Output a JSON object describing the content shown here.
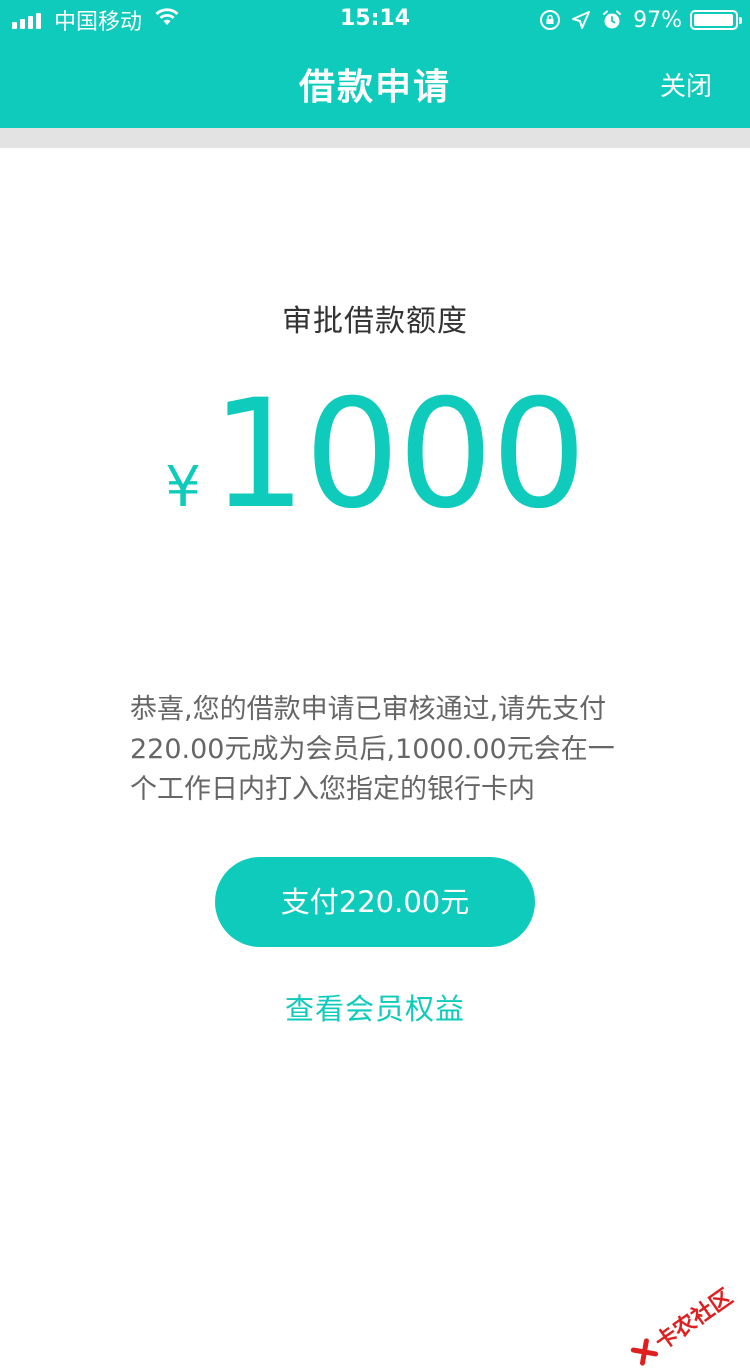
{
  "status_bar": {
    "carrier": "中国移动",
    "time": "15:14",
    "battery_percent": "97%",
    "battery_level": 0.97
  },
  "nav": {
    "title": "借款申请",
    "close_label": "关闭"
  },
  "loan": {
    "label": "审批借款额度",
    "currency_symbol": "¥",
    "amount": "1000",
    "notice": "恭喜,您的借款申请已审核通过,请先支付220.00元成为会员后,1000.00元会在一个工作日内打入您指定的银行卡内"
  },
  "actions": {
    "pay_label": "支付220.00元",
    "benefits_label": "查看会员权益"
  },
  "watermark": {
    "text": "卡农社区"
  },
  "colors": {
    "accent": "#0fcbbb",
    "divider": "#e3e3e3",
    "watermark": "#e02020"
  }
}
